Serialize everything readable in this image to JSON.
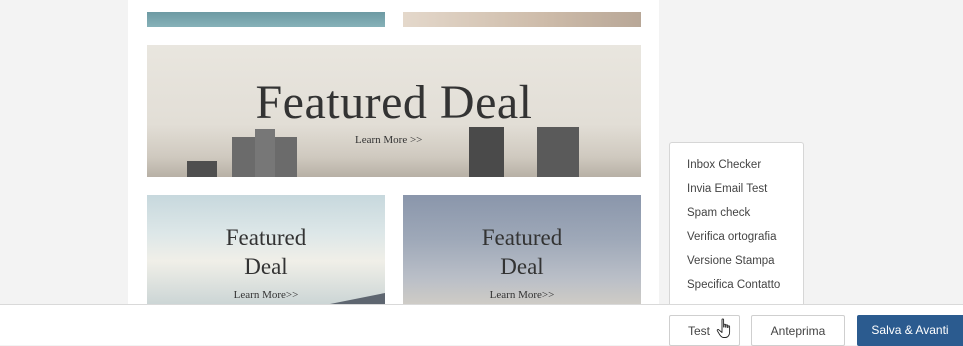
{
  "banner": {
    "title": "Featured Deal",
    "learn_more": "Learn More >>"
  },
  "cards": [
    {
      "title_line1": "Featured",
      "title_line2": "Deal",
      "learn_more": "Learn More>>"
    },
    {
      "title_line1": "Featured",
      "title_line2": "Deal",
      "learn_more": "Learn More>>"
    }
  ],
  "test_menu": {
    "items": [
      "Inbox Checker",
      "Invia Email Test",
      "Spam check",
      "Verifica ortografia",
      "Versione Stampa",
      "Specifica Contatto"
    ]
  },
  "toolbar": {
    "test_label": "Test",
    "preview_label": "Anteprima",
    "save_label": "Salva & Avanti"
  },
  "colors": {
    "primary_button": "#2b5b8f",
    "background": "#f3f3f3"
  },
  "icons": {
    "cursor": "hand-pointer-icon"
  }
}
